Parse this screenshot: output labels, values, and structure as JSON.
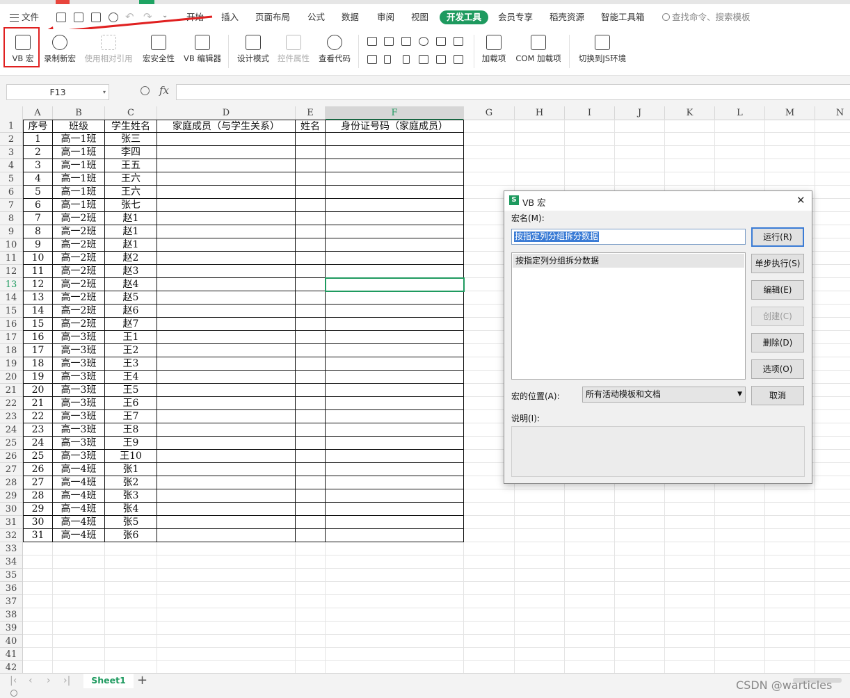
{
  "menu": {
    "file": "文件",
    "tabs": [
      "开始",
      "插入",
      "页面布局",
      "公式",
      "数据",
      "审阅",
      "视图",
      "开发工具",
      "会员专享",
      "稻壳资源",
      "智能工具箱"
    ],
    "search": "查找命令、搜索模板"
  },
  "ribbon": {
    "vb_macro": "VB 宏",
    "record_macro": "录制新宏",
    "relative_ref": "使用相对引用",
    "macro_security": "宏安全性",
    "vb_editor": "VB 编辑器",
    "design_mode": "设计模式",
    "control_props": "控件属性",
    "view_code": "查看代码",
    "addins": "加载项",
    "com_addins": "COM 加载项",
    "switch_js": "切换到JS环境"
  },
  "formula_bar": {
    "name_box": "F13",
    "fx": "fx"
  },
  "grid": {
    "columns": [
      "A",
      "B",
      "C",
      "D",
      "E",
      "F",
      "G",
      "H",
      "I",
      "J",
      "K",
      "L",
      "M",
      "N"
    ],
    "selected_col": "F",
    "selected_row": "13",
    "header_row": [
      "序号",
      "班级",
      "学生姓名",
      "家庭成员（与学生关系）",
      "姓名",
      "身份证号码（家庭成员）"
    ],
    "rows": [
      [
        "1",
        "高一1班",
        "张三"
      ],
      [
        "2",
        "高一1班",
        "李四"
      ],
      [
        "3",
        "高一1班",
        "王五"
      ],
      [
        "4",
        "高一1班",
        "王六"
      ],
      [
        "5",
        "高一1班",
        "王六"
      ],
      [
        "6",
        "高一1班",
        "张七"
      ],
      [
        "7",
        "高一2班",
        "赵1"
      ],
      [
        "8",
        "高一2班",
        "赵1"
      ],
      [
        "9",
        "高一2班",
        "赵1"
      ],
      [
        "10",
        "高一2班",
        "赵2"
      ],
      [
        "11",
        "高一2班",
        "赵3"
      ],
      [
        "12",
        "高一2班",
        "赵4"
      ],
      [
        "13",
        "高一2班",
        "赵5"
      ],
      [
        "14",
        "高一2班",
        "赵6"
      ],
      [
        "15",
        "高一2班",
        "赵7"
      ],
      [
        "16",
        "高一3班",
        "王1"
      ],
      [
        "17",
        "高一3班",
        "王2"
      ],
      [
        "18",
        "高一3班",
        "王3"
      ],
      [
        "19",
        "高一3班",
        "王4"
      ],
      [
        "20",
        "高一3班",
        "王5"
      ],
      [
        "21",
        "高一3班",
        "王6"
      ],
      [
        "22",
        "高一3班",
        "王7"
      ],
      [
        "23",
        "高一3班",
        "王8"
      ],
      [
        "24",
        "高一3班",
        "王9"
      ],
      [
        "25",
        "高一3班",
        "王10"
      ],
      [
        "26",
        "高一4班",
        "张1"
      ],
      [
        "27",
        "高一4班",
        "张2"
      ],
      [
        "28",
        "高一4班",
        "张3"
      ],
      [
        "29",
        "高一4班",
        "张4"
      ],
      [
        "30",
        "高一4班",
        "张5"
      ],
      [
        "31",
        "高一4班",
        "张6"
      ]
    ],
    "row_numbers": [
      "1",
      "2",
      "3",
      "4",
      "5",
      "6",
      "7",
      "8",
      "9",
      "10",
      "11",
      "12",
      "13",
      "14",
      "15",
      "16",
      "17",
      "18",
      "19",
      "20",
      "21",
      "22",
      "23",
      "24",
      "25",
      "26",
      "27",
      "28",
      "29",
      "30",
      "31",
      "32",
      "33",
      "34",
      "35",
      "36",
      "37",
      "38",
      "39",
      "40",
      "41",
      "42"
    ]
  },
  "sheets": {
    "active": "Sheet1",
    "add": "+"
  },
  "dialog": {
    "title": "VB 宏",
    "macro_name_label": "宏名(M):",
    "macro_name_value": "按指定列分组拆分数据",
    "list_items": [
      "按指定列分组拆分数据"
    ],
    "location_label": "宏的位置(A):",
    "location_value": "所有活动模板和文档",
    "description_label": "说明(I):",
    "buttons": {
      "run": "运行(R)",
      "step": "单步执行(S)",
      "edit": "编辑(E)",
      "create": "创建(C)",
      "delete": "删除(D)",
      "options": "选项(O)",
      "cancel": "取消"
    },
    "close": "✕"
  },
  "watermark": "CSDN @warticles",
  "colors": {
    "accent": "#1e9a5f",
    "highlight": "#e02020",
    "selection": "#3a7bd5"
  }
}
